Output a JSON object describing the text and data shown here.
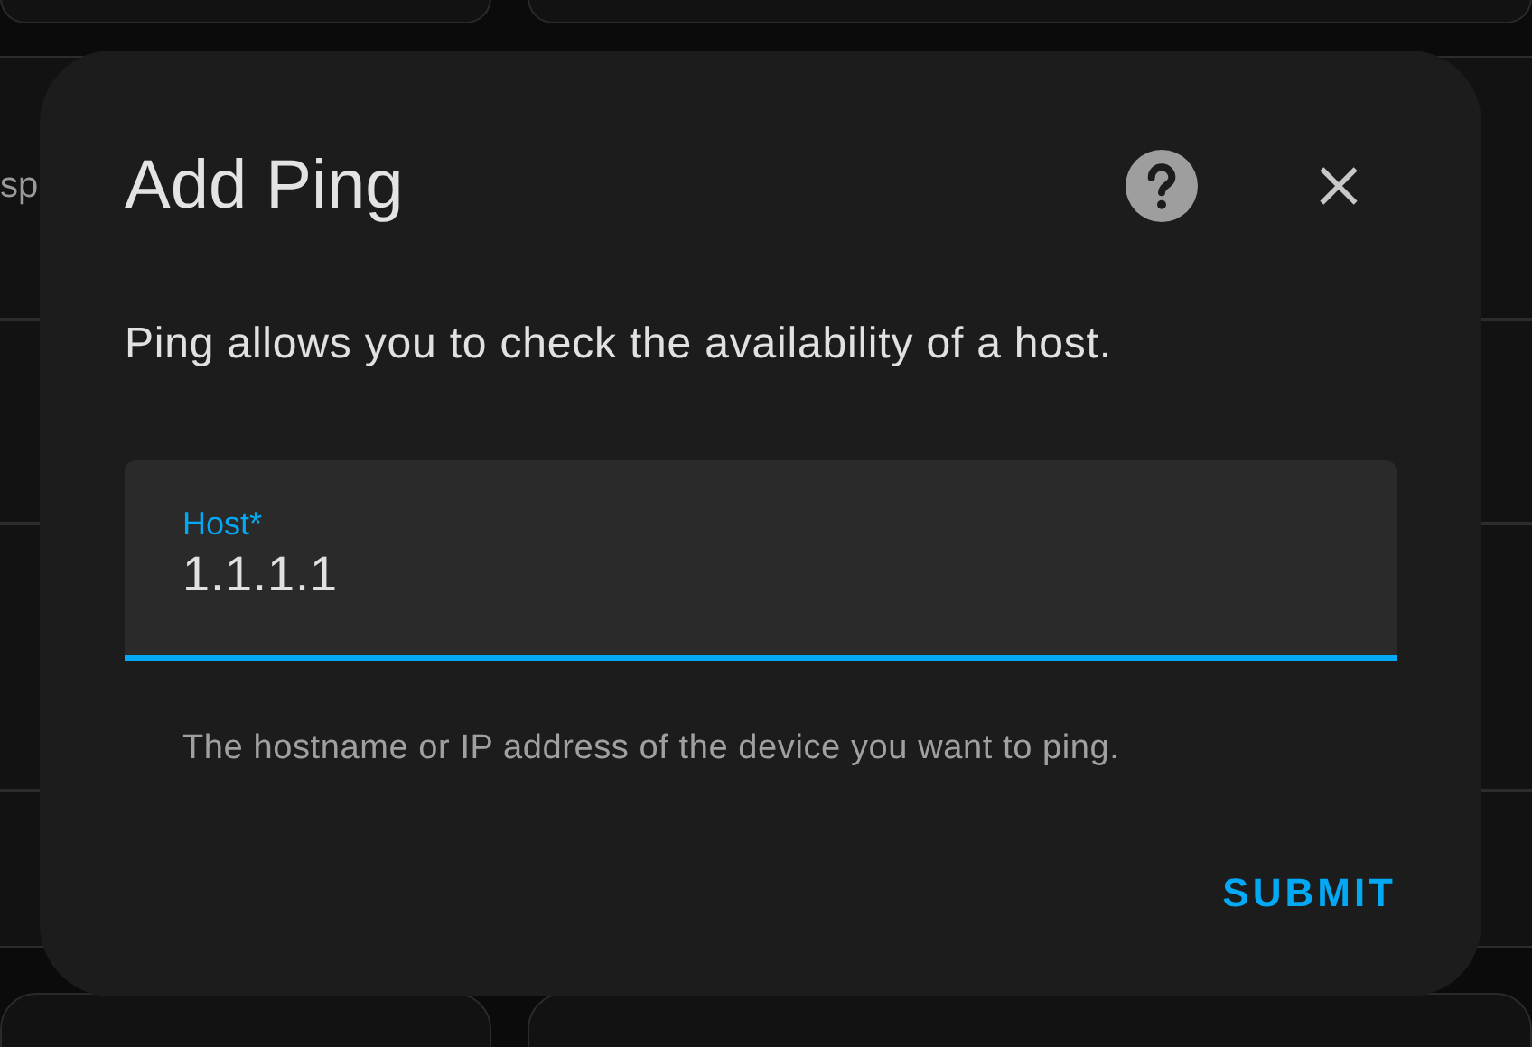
{
  "background": {
    "partial_text": "sp"
  },
  "dialog": {
    "title": "Add Ping",
    "description": "Ping allows you to check the availability of a host.",
    "field": {
      "label": "Host*",
      "value": "1.1.1.1",
      "helper": "The hostname or IP address of the device you want to ping."
    },
    "buttons": [
      "SUBMIT"
    ]
  }
}
